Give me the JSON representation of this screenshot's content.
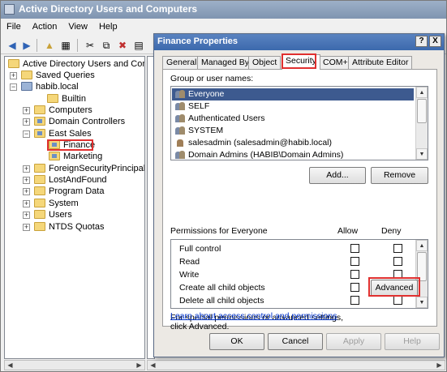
{
  "mmc": {
    "title": "Active Directory Users and Computers",
    "menu": [
      "File",
      "Action",
      "View",
      "Help"
    ]
  },
  "tree": {
    "root": "Active Directory Users and Comput",
    "items": [
      {
        "label": "Saved Queries"
      },
      {
        "label": "habib.local"
      },
      {
        "label": "Builtin"
      },
      {
        "label": "Computers"
      },
      {
        "label": "Domain Controllers"
      },
      {
        "label": "East Sales"
      },
      {
        "label": "Finance"
      },
      {
        "label": "Marketing"
      },
      {
        "label": "ForeignSecurityPrincipals"
      },
      {
        "label": "LostAndFound"
      },
      {
        "label": "Program Data"
      },
      {
        "label": "System"
      },
      {
        "label": "Users"
      },
      {
        "label": "NTDS Quotas"
      }
    ]
  },
  "dialog": {
    "title": "Finance Properties",
    "help_button": "?",
    "close_button": "X",
    "tabs": [
      "General",
      "Managed By",
      "Object",
      "Security",
      "COM+",
      "Attribute Editor"
    ],
    "active_tab": "Security",
    "group_label": "Group or user names:",
    "users": [
      "Everyone",
      "SELF",
      "Authenticated Users",
      "SYSTEM",
      "salesadmin (salesadmin@habib.local)",
      "Domain Admins (HABIB\\Domain Admins)"
    ],
    "add_button": "Add...",
    "remove_button": "Remove",
    "permissions_label": "Permissions for Everyone",
    "allow_header": "Allow",
    "deny_header": "Deny",
    "permissions": [
      "Full control",
      "Read",
      "Write",
      "Create all child objects",
      "Delete all child objects"
    ],
    "special_text": "For special permissions or advanced settings, click Advanced.",
    "advanced_button": "Advanced",
    "learn_link": "Learn about access control and permissions",
    "ok_button": "OK",
    "cancel_button": "Cancel",
    "apply_button": "Apply",
    "help_bottom_button": "Help"
  },
  "colors": {
    "highlight_red": "#e0302f",
    "selection_blue": "#3d5a8f",
    "title_blue": "#3c69ad"
  }
}
